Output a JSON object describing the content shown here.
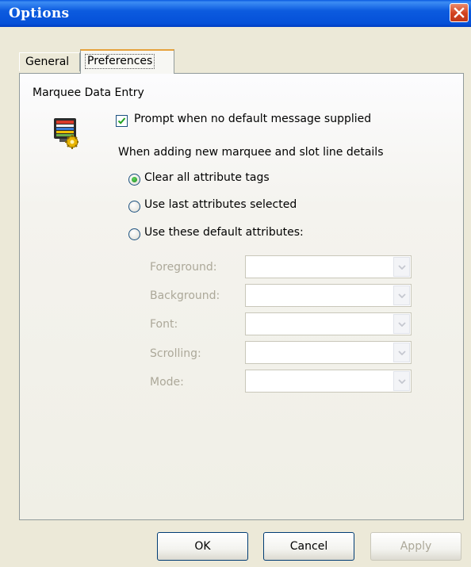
{
  "window": {
    "title": "Options"
  },
  "tabs": [
    {
      "label": "General"
    },
    {
      "label": "Preferences"
    }
  ],
  "group": {
    "title": "Marquee Data Entry"
  },
  "prompt_checkbox": {
    "label": "Prompt when no default message supplied",
    "checked": true
  },
  "adding_heading": "When adding new marquee and slot line details",
  "radios": [
    {
      "label": "Clear all attribute tags",
      "checked": true
    },
    {
      "label": "Use last attributes selected",
      "checked": false
    },
    {
      "label": "Use these default attributes:",
      "checked": false
    }
  ],
  "fields": [
    {
      "label": "Foreground:",
      "value": ""
    },
    {
      "label": "Background:",
      "value": ""
    },
    {
      "label": "Font:",
      "value": ""
    },
    {
      "label": "Scrolling:",
      "value": ""
    },
    {
      "label": "Mode:",
      "value": ""
    }
  ],
  "buttons": {
    "ok": "OK",
    "cancel": "Cancel",
    "apply": "Apply"
  }
}
